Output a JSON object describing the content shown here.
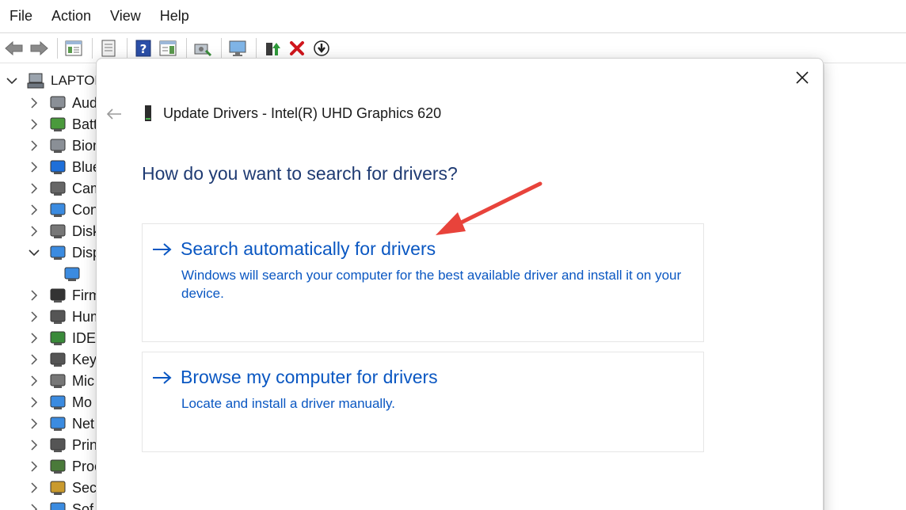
{
  "menu": {
    "file": "File",
    "action": "Action",
    "view": "View",
    "help": "Help"
  },
  "toolbar": {
    "icons": [
      "back-arrow-icon",
      "forward-arrow-icon",
      "properties-icon",
      "console-tree-icon",
      "help-icon",
      "action-pane-icon",
      "scan-hardware-icon",
      "monitor-icon",
      "update-driver-icon",
      "uninstall-icon",
      "disable-device-icon"
    ]
  },
  "tree": {
    "root_label": "LAPTOP",
    "items": [
      {
        "label": "Aud",
        "icon": "audio-icon"
      },
      {
        "label": "Batt",
        "icon": "battery-icon"
      },
      {
        "label": "Biom",
        "icon": "biometric-icon"
      },
      {
        "label": "Blue",
        "icon": "bluetooth-icon"
      },
      {
        "label": "Cam",
        "icon": "camera-icon"
      },
      {
        "label": "Con",
        "icon": "computer-icon"
      },
      {
        "label": "Disk",
        "icon": "disk-icon"
      },
      {
        "label": "Disp",
        "icon": "display-adapter-icon",
        "expanded": true
      },
      {
        "label": "",
        "icon": "display-child-icon"
      },
      {
        "label": "Firm",
        "icon": "firmware-icon"
      },
      {
        "label": "Hum",
        "icon": "hid-icon"
      },
      {
        "label": "IDE",
        "icon": "ide-icon"
      },
      {
        "label": "Key",
        "icon": "keyboard-icon"
      },
      {
        "label": "Mic",
        "icon": "mouse-icon"
      },
      {
        "label": "Mo",
        "icon": "monitor-icon"
      },
      {
        "label": "Net",
        "icon": "network-icon"
      },
      {
        "label": "Prin",
        "icon": "printer-icon"
      },
      {
        "label": "Proc",
        "icon": "processor-icon"
      },
      {
        "label": "Sec",
        "icon": "security-icon"
      },
      {
        "label": "Sof",
        "icon": "software-icon"
      }
    ]
  },
  "dialog": {
    "title": "Update Drivers - Intel(R) UHD Graphics 620",
    "question": "How do you want to search for drivers?",
    "options": [
      {
        "title": "Search automatically for drivers",
        "description": "Windows will search your computer for the best available driver and install it on your device."
      },
      {
        "title": "Browse my computer for drivers",
        "description": "Locate and install a driver manually."
      }
    ]
  },
  "colors": {
    "link_blue": "#0a57c2",
    "heading_blue": "#1f3b73",
    "annotation_red": "#e8433b"
  }
}
